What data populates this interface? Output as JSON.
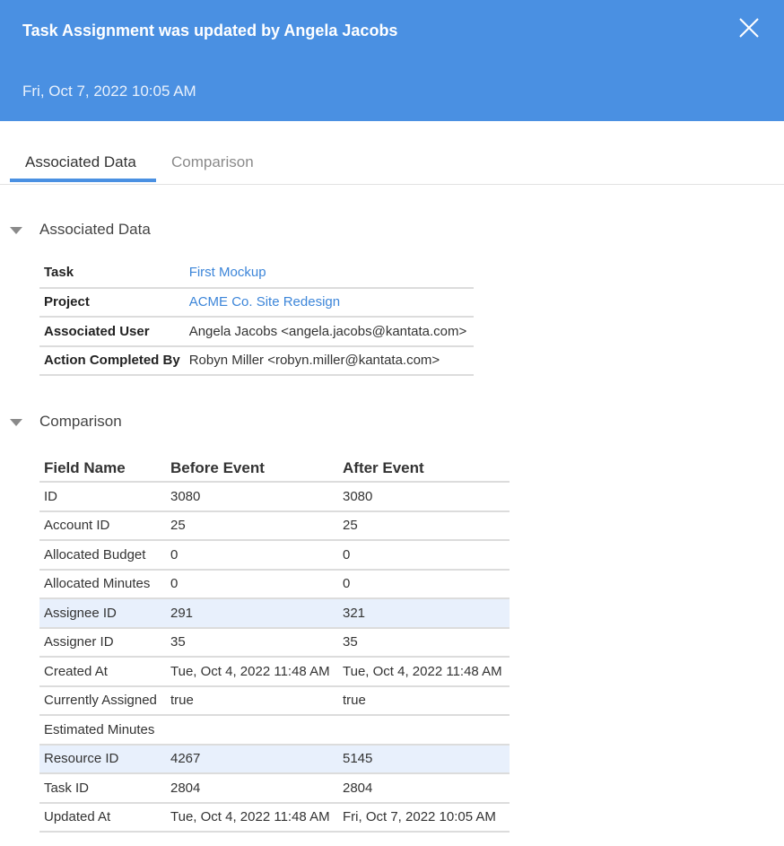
{
  "header": {
    "title": "Task Assignment was updated by Angela Jacobs",
    "date": "Fri, Oct 7, 2022 10:05 AM",
    "close_icon": "close-icon",
    "background": "#4a90e2"
  },
  "tabs": [
    {
      "label": "Associated Data",
      "active": true
    },
    {
      "label": "Comparison",
      "active": false
    }
  ],
  "associated": {
    "title": "Associated Data",
    "rows": [
      {
        "key": "Task",
        "value": "First Mockup",
        "link": true
      },
      {
        "key": "Project",
        "value": "ACME Co. Site Redesign",
        "link": true
      },
      {
        "key": "Associated User",
        "value": "Angela Jacobs <angela.jacobs@kantata.com>",
        "link": false
      },
      {
        "key": "Action Completed By",
        "value": "Robyn Miller <robyn.miller@kantata.com>",
        "link": false
      }
    ]
  },
  "comparison": {
    "title": "Comparison",
    "headers": [
      "Field Name",
      "Before Event",
      "After Event"
    ],
    "rows": [
      {
        "field": "ID",
        "before": "3080",
        "after": "3080",
        "changed": false
      },
      {
        "field": "Account ID",
        "before": "25",
        "after": "25",
        "changed": false
      },
      {
        "field": "Allocated Budget",
        "before": "0",
        "after": "0",
        "changed": false
      },
      {
        "field": "Allocated Minutes",
        "before": "0",
        "after": "0",
        "changed": false
      },
      {
        "field": "Assignee ID",
        "before": "291",
        "after": "321",
        "changed": true
      },
      {
        "field": "Assigner ID",
        "before": "35",
        "after": "35",
        "changed": false
      },
      {
        "field": "Created At",
        "before": "Tue, Oct 4, 2022 11:48 AM",
        "after": "Tue, Oct 4, 2022 11:48 AM",
        "changed": false
      },
      {
        "field": "Currently Assigned",
        "before": "true",
        "after": "true",
        "changed": false
      },
      {
        "field": "Estimated Minutes",
        "before": "",
        "after": "",
        "changed": false
      },
      {
        "field": "Resource ID",
        "before": "4267",
        "after": "5145",
        "changed": true
      },
      {
        "field": "Task ID",
        "before": "2804",
        "after": "2804",
        "changed": false
      },
      {
        "field": "Updated At",
        "before": "Tue, Oct 4, 2022 11:48 AM",
        "after": "Fri, Oct 7, 2022 10:05 AM",
        "changed": false
      }
    ]
  },
  "colors": {
    "accent": "#4a90e2",
    "link": "#3d86d9",
    "changed_row": "#e8f0fc"
  }
}
